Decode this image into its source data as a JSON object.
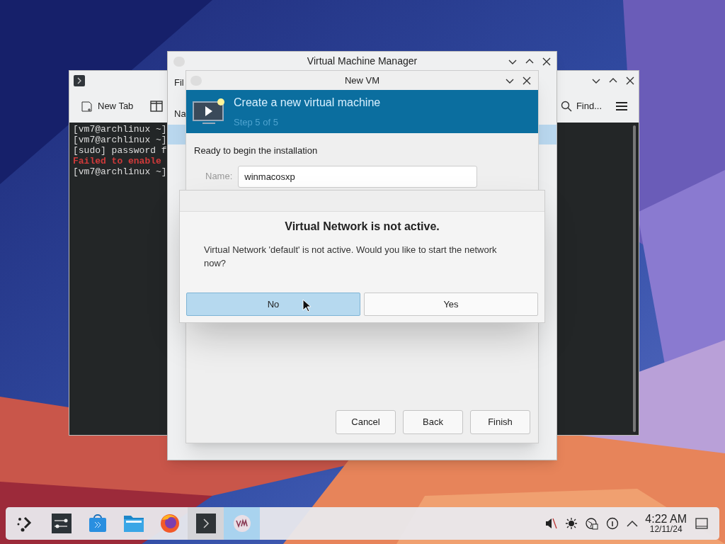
{
  "terminal": {
    "new_tab": "New Tab",
    "find": "Find...",
    "lines": [
      {
        "kind": "normal",
        "text": "[vm7@archlinux ~]"
      },
      {
        "kind": "normal",
        "text": "[vm7@archlinux ~]"
      },
      {
        "kind": "normal",
        "text": "[sudo] password f"
      },
      {
        "kind": "error",
        "text": "Failed to enable"
      },
      {
        "kind": "normal",
        "text": "[vm7@archlinux ~]"
      }
    ]
  },
  "vmm": {
    "title": "Virtual Machine Manager",
    "menu_item": "Fil",
    "column_header": "Na"
  },
  "new_vm": {
    "title": "New VM",
    "heading": "Create a new virtual machine",
    "step": "Step 5 of 5",
    "intro": "Ready to begin the installation",
    "name_label": "Name:",
    "name_value": "winmacosxp",
    "buttons": [
      "Cancel",
      "Back",
      "Finish"
    ]
  },
  "dialog": {
    "title": "Virtual Network is not active.",
    "message": "Virtual Network 'default' is not active. Would you like to start the network now?",
    "buttons": [
      {
        "label": "No",
        "selected": true
      },
      {
        "label": "Yes",
        "selected": false
      }
    ]
  },
  "taskbar": {
    "items": [
      {
        "kind": "launcher",
        "open": false,
        "selected": false
      },
      {
        "kind": "settings",
        "open": false,
        "selected": false
      },
      {
        "kind": "store",
        "open": false,
        "selected": false
      },
      {
        "kind": "files",
        "open": false,
        "selected": false
      },
      {
        "kind": "browser",
        "open": false,
        "selected": false
      },
      {
        "kind": "terminal",
        "open": true,
        "selected": false
      },
      {
        "kind": "vm",
        "open": true,
        "selected": true
      }
    ],
    "tray": [
      {
        "kind": "mute"
      },
      {
        "kind": "brightness"
      },
      {
        "kind": "network"
      },
      {
        "kind": "gauge"
      },
      {
        "kind": "expand"
      }
    ],
    "time": "4:22 AM",
    "date": "12/11/24"
  }
}
